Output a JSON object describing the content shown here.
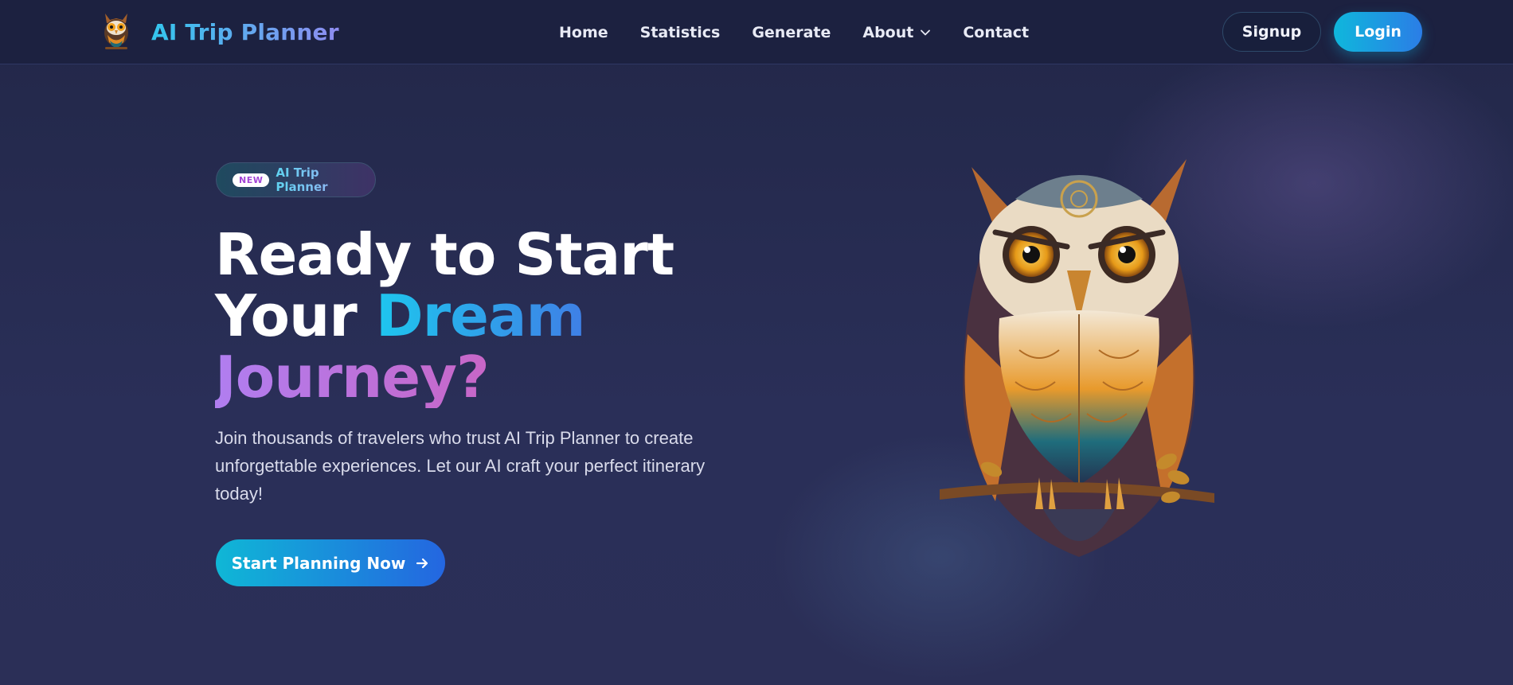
{
  "nav": {
    "brand_name": "AI Trip Planner",
    "links": [
      {
        "label": "Home"
      },
      {
        "label": "Statistics"
      },
      {
        "label": "Generate"
      },
      {
        "label": "About",
        "has_dropdown": true
      },
      {
        "label": "Contact"
      }
    ],
    "signup_label": "Signup",
    "login_label": "Login"
  },
  "hero": {
    "badge_tag": "NEW",
    "badge_text": "AI Trip Planner",
    "headline_line1": "Ready to Start",
    "headline_line2_plain": "Your ",
    "headline_line2_accent": "Dream",
    "headline_line3": "Journey?",
    "subtext": "Join thousands of travelers who trust AI Trip Planner to create unforgettable experiences. Let our AI craft your perfect itinerary today!",
    "cta_label": "Start Planning Now",
    "cta_icon": "arrow-right-icon",
    "illustration": "owl-mascot"
  },
  "colors": {
    "background": "#262b4f",
    "navbar": "#1c2140",
    "accent_cyan": "#1ec6ee",
    "accent_blue": "#2b7de6",
    "accent_purple": "#b07ef0",
    "accent_pink": "#e24c9a"
  }
}
